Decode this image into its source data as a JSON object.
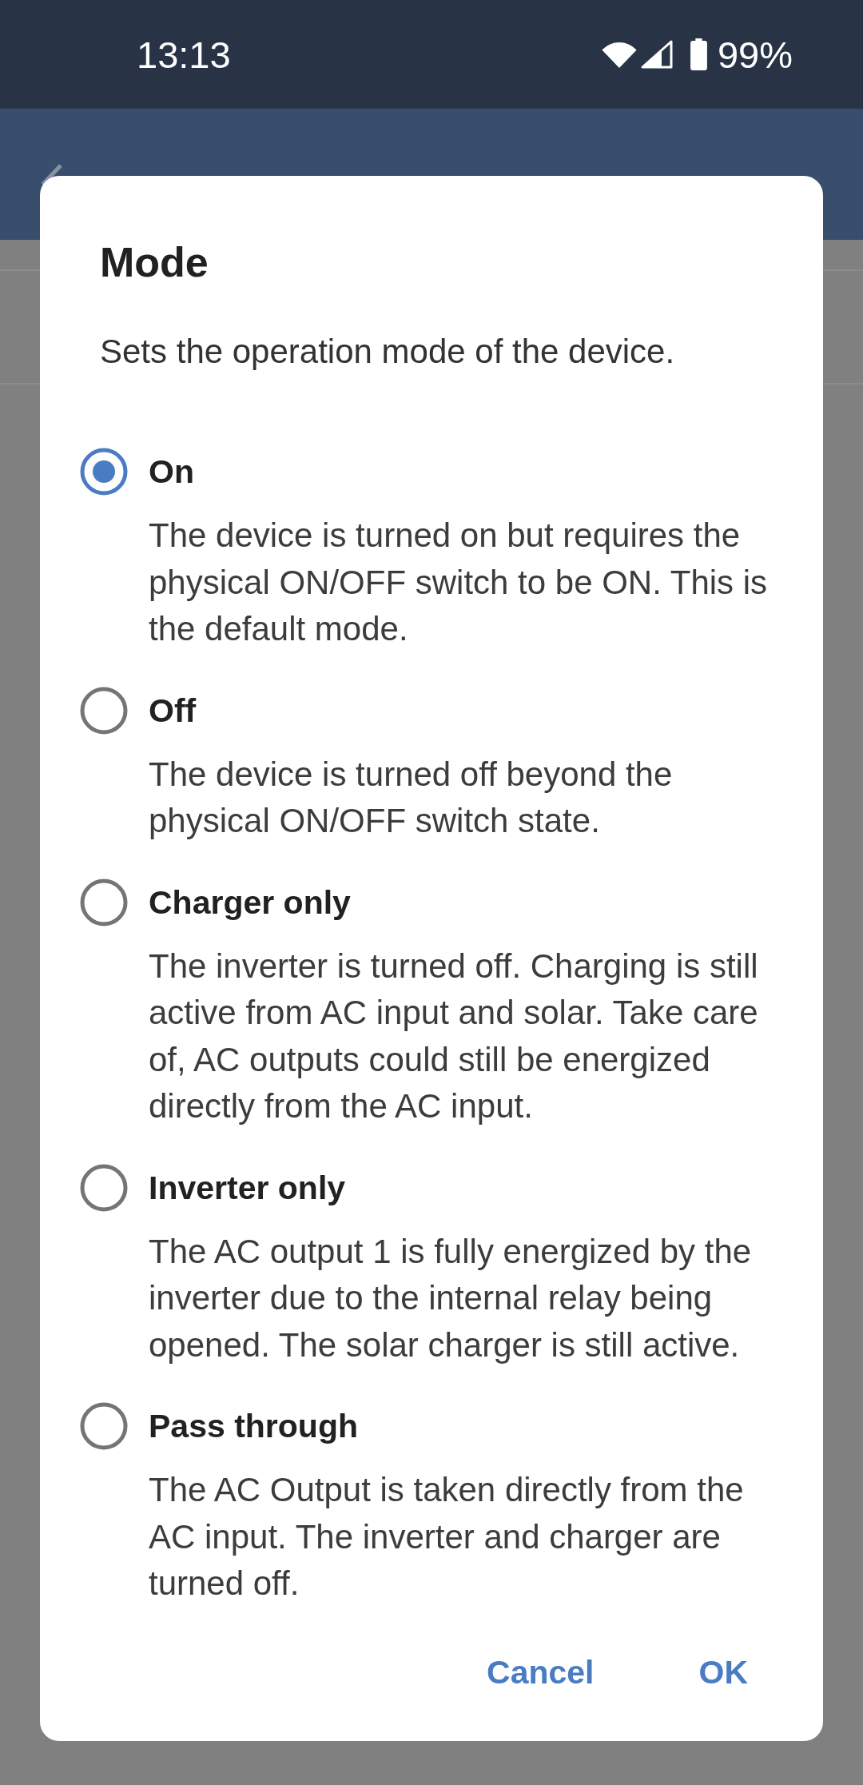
{
  "status_bar": {
    "time": "13:13",
    "battery": "99%"
  },
  "dialog": {
    "title": "Mode",
    "message": "Sets the operation mode of the device.",
    "options": [
      {
        "label": "On",
        "description": "The device is turned on but requires the physical ON/OFF switch to be ON. This is the default mode.",
        "selected": true
      },
      {
        "label": "Off",
        "description": "The device is turned off beyond the physical ON/OFF switch state.",
        "selected": false
      },
      {
        "label": "Charger only",
        "description": "The inverter is turned off. Charging is still active from AC input and solar. Take care of, AC outputs could still be energized directly from the AC input.",
        "selected": false
      },
      {
        "label": "Inverter only",
        "description": "The AC output 1 is fully energized by the inverter due to the internal relay being opened. The solar charger is still active.",
        "selected": false
      },
      {
        "label": "Pass through",
        "description": "The AC Output is taken directly from the AC input. The inverter and charger are turned off.",
        "selected": false
      }
    ],
    "buttons": [
      "Cancel",
      "OK"
    ]
  }
}
